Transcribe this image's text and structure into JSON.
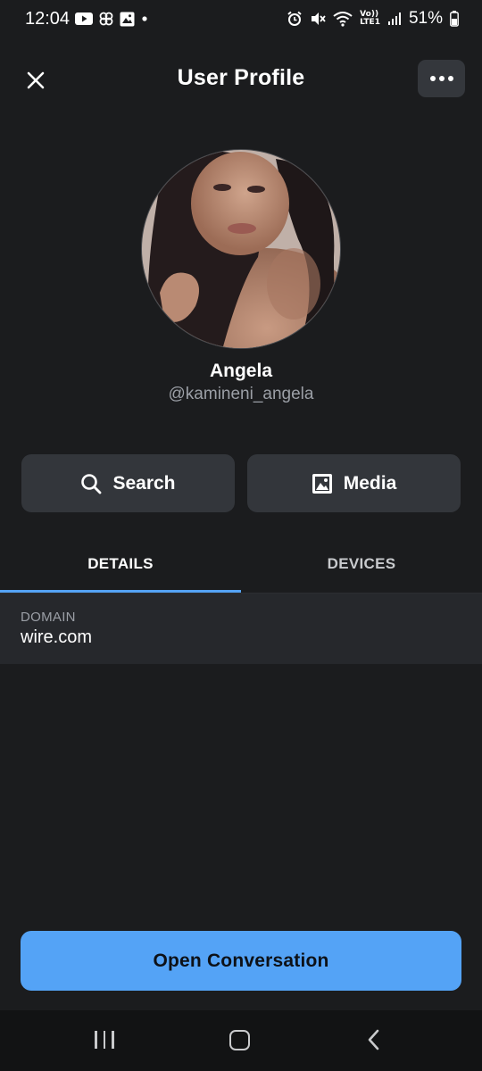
{
  "status_bar": {
    "time": "12:04",
    "battery_text": "51%",
    "left_icons": [
      "youtube-icon",
      "pinwheel-icon",
      "gallery-icon",
      "dot-icon"
    ],
    "right_icons": [
      "alarm-icon",
      "mute-icon",
      "wifi-icon",
      "volte-icon",
      "signal-icon",
      "battery-icon"
    ],
    "volte_label": "Vo))",
    "lte_label": "LTE1"
  },
  "header": {
    "title": "User Profile",
    "close_icon": "close-icon",
    "more_icon": "more-icon"
  },
  "profile": {
    "name": "Angela",
    "handle": "@kamineni_angela"
  },
  "actions": {
    "search_label": "Search",
    "media_label": "Media"
  },
  "tabs": [
    {
      "label": "DETAILS",
      "active": true
    },
    {
      "label": "DEVICES",
      "active": false
    }
  ],
  "details": {
    "domain_label": "DOMAIN",
    "domain_value": "wire.com"
  },
  "footer": {
    "open_conversation_label": "Open Conversation"
  },
  "colors": {
    "background": "#1b1c1e",
    "accent": "#54a3f6",
    "button_bg": "#33363b",
    "panel_bg": "#26282c"
  }
}
